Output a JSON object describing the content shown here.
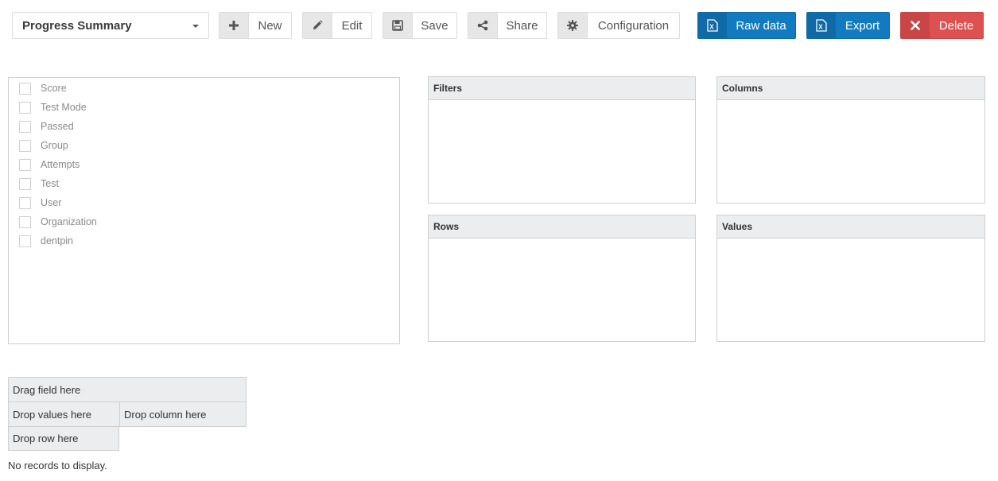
{
  "toolbar": {
    "report_select": {
      "value": "Progress Summary"
    },
    "buttons": {
      "new": {
        "label": "New",
        "icon": "plus-icon"
      },
      "edit": {
        "label": "Edit",
        "icon": "pencil-icon"
      },
      "save": {
        "label": "Save",
        "icon": "floppy-disk-icon"
      },
      "share": {
        "label": "Share",
        "icon": "share-icon"
      },
      "configuration": {
        "label": "Configuration",
        "icon": "gear-icon"
      },
      "raw_data": {
        "label": "Raw data",
        "icon": "excel-icon",
        "color": "#127bbf"
      },
      "export": {
        "label": "Export",
        "icon": "excel-icon",
        "color": "#127bbf"
      },
      "delete": {
        "label": "Delete",
        "icon": "close-icon",
        "color": "#dd5251"
      }
    }
  },
  "field_list": [
    {
      "label": "Score",
      "checked": false
    },
    {
      "label": "Test Mode",
      "checked": false
    },
    {
      "label": "Passed",
      "checked": false
    },
    {
      "label": "Group",
      "checked": false
    },
    {
      "label": "Attempts",
      "checked": false
    },
    {
      "label": "Test",
      "checked": false
    },
    {
      "label": "User",
      "checked": false
    },
    {
      "label": "Organization",
      "checked": false
    },
    {
      "label": "dentpin",
      "checked": false
    }
  ],
  "zones": {
    "filters": {
      "title": "Filters"
    },
    "columns": {
      "title": "Columns"
    },
    "rows": {
      "title": "Rows"
    },
    "values": {
      "title": "Values"
    }
  },
  "pivot_grid": {
    "drag_field": "Drag field here",
    "drop_values": "Drop values here",
    "drop_column": "Drop column here",
    "drop_row": "Drop row here"
  },
  "empty_message": "No records to display."
}
